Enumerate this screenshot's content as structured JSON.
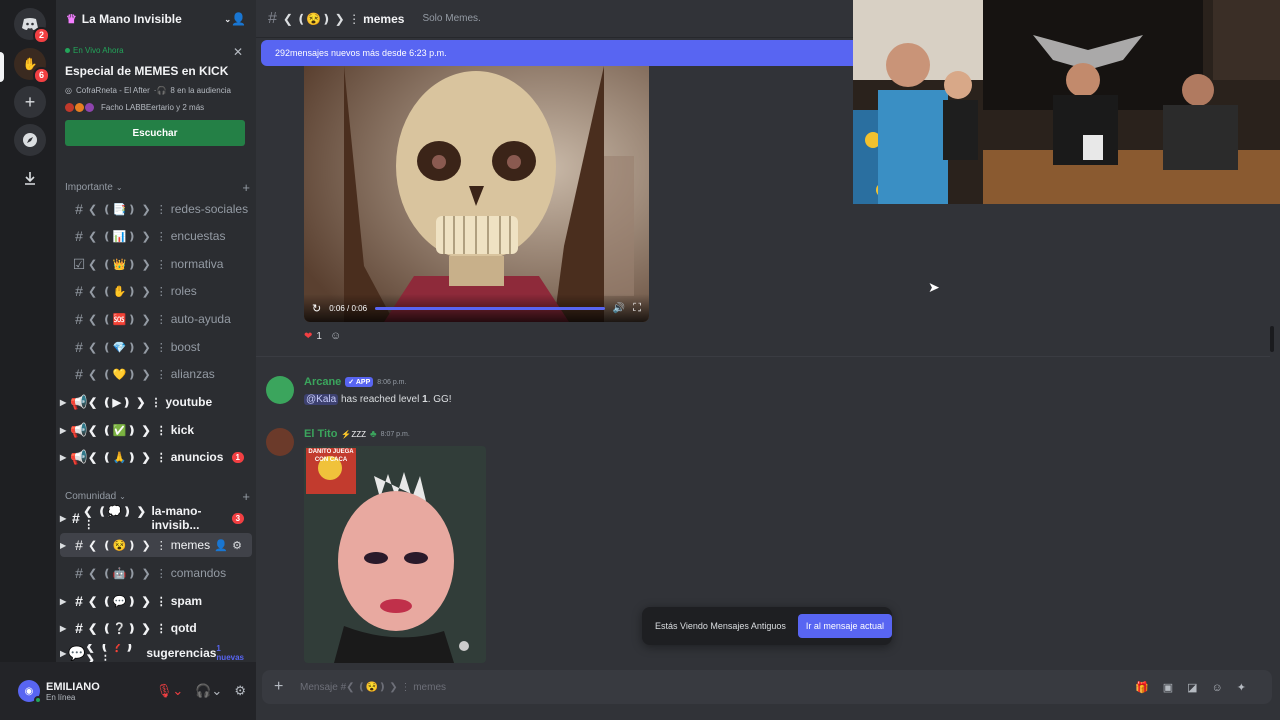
{
  "server": {
    "name": "La Mano Invisible",
    "rail_badges": [
      "2",
      "6"
    ]
  },
  "live": {
    "badge": "En Vivo Ahora",
    "title": "Especial de MEMES en KICK",
    "host": "CofraRneta - El After",
    "audience": "8 en la audiencia",
    "users": "Facho LABBEertario y 2 más",
    "listen_label": "Escuchar"
  },
  "categories": {
    "importante": "Importante",
    "comunidad": "Comunidad"
  },
  "channels": [
    {
      "deco": "❮ ❪📑❫ ❯ ⋮",
      "name": "redes-sociales"
    },
    {
      "deco": "❮ ❪📊❫ ❯ ⋮",
      "name": "encuestas"
    },
    {
      "deco": "❮ ❪👑❫ ❯ ⋮",
      "name": "normativa"
    },
    {
      "deco": "❮ ❪✋❫ ❯ ⋮",
      "name": "roles"
    },
    {
      "deco": "❮ ❪🆘❫ ❯ ⋮",
      "name": "auto-ayuda"
    },
    {
      "deco": "❮ ❪💎❫ ❯ ⋮",
      "name": "boost"
    },
    {
      "deco": "❮ ❪💛❫ ❯ ⋮",
      "name": "alianzas"
    },
    {
      "deco": "❮ ❪▶❫ ❯ ⋮",
      "name": "youtube"
    },
    {
      "deco": "❮ ❪✅❫ ❯ ⋮",
      "name": "kick"
    },
    {
      "deco": "❮ ❪🙏❫ ❯ ⋮",
      "name": "anuncios",
      "badge": "1"
    },
    {
      "deco": "❮ ❪💭❫ ❯ ⋮",
      "name": "la-mano-invisib...",
      "badge": "3"
    },
    {
      "deco": "❮ ❪😵❫ ❯ ⋮",
      "name": "memes"
    },
    {
      "deco": "❮ ❪🤖❫ ❯ ⋮",
      "name": "comandos"
    },
    {
      "deco": "❮ ❪💬❫ ❯ ⋮",
      "name": "spam"
    },
    {
      "deco": "❮ ❪❔❫ ❯ ⋮",
      "name": "qotd"
    },
    {
      "deco": "❮ ❪❓❫ ❯ ⋮",
      "name": "sugerencias",
      "tag": "1 nuevas"
    }
  ],
  "user": {
    "name": "EMILIANO",
    "status": "En línea"
  },
  "header": {
    "channel_deco": "❮ ❪😵❫ ❯ ⋮",
    "channel_name": "memes",
    "topic": "Solo Memes."
  },
  "new_messages_bar": "292mensajes nuevos más desde 6:23 p.m.",
  "video": {
    "time": "0:06 / 0:06",
    "progress": 1.0
  },
  "reaction": {
    "count": "1"
  },
  "messages": [
    {
      "author": "Arcane",
      "tag": "✓ APP",
      "time": "8:06 p.m.",
      "mention": "@Kala",
      "text_before": " has reached level ",
      "level": "1",
      "text_after": ". GG!"
    },
    {
      "author": "El Tito",
      "tag": "⚡ZZZ",
      "time": "8:07 p.m."
    }
  ],
  "meme_caption": "DANITO JUEGA CON CACA",
  "toast": {
    "text": "Estás Viendo Mensajes Antiguos",
    "button": "Ir al mensaje actual"
  },
  "composer": {
    "placeholder": "Mensaje #❮ ❪😵❫ ❯ ⋮ memes"
  },
  "colors": {
    "blurple": "#5865f2",
    "green": "#248046",
    "red": "#f23f42",
    "arcane": "#3ba55d",
    "el_tito": "#3ba55d"
  }
}
